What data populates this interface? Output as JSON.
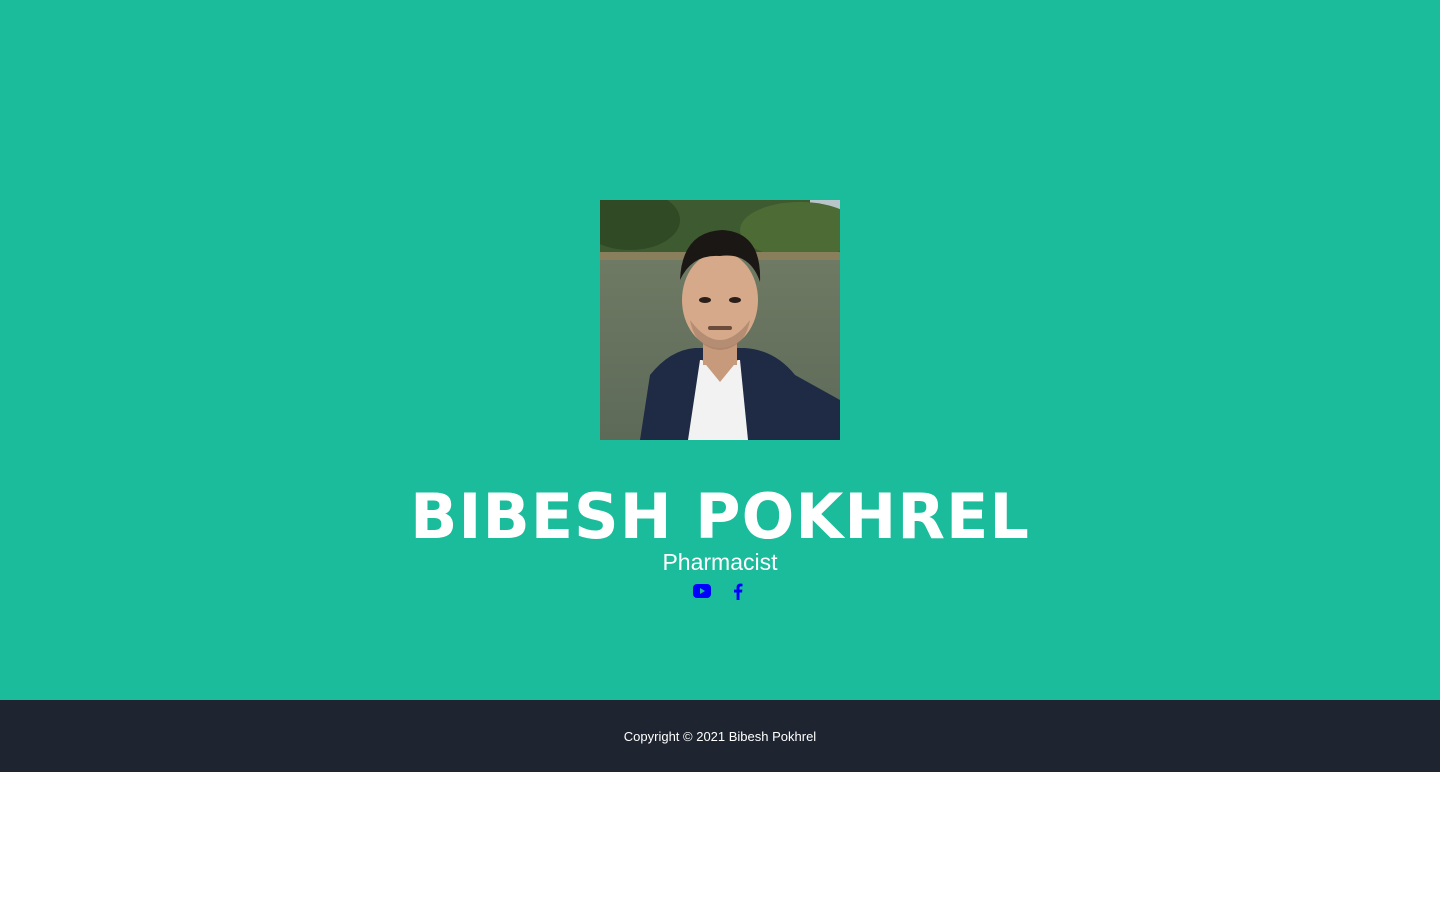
{
  "colors": {
    "hero_bg": "#1abc9c",
    "footer_bg": "#1e2530",
    "text": "#ffffff",
    "icon": "#0000ff"
  },
  "profile": {
    "name": "BIBESH POKHREL",
    "role": "Pharmacist",
    "photo_alt": "Bibesh Pokhrel"
  },
  "social": [
    {
      "icon": "youtube-icon"
    },
    {
      "icon": "facebook-icon"
    }
  ],
  "footer": {
    "copyright": "Copyright © 2021 Bibesh Pokhrel"
  }
}
